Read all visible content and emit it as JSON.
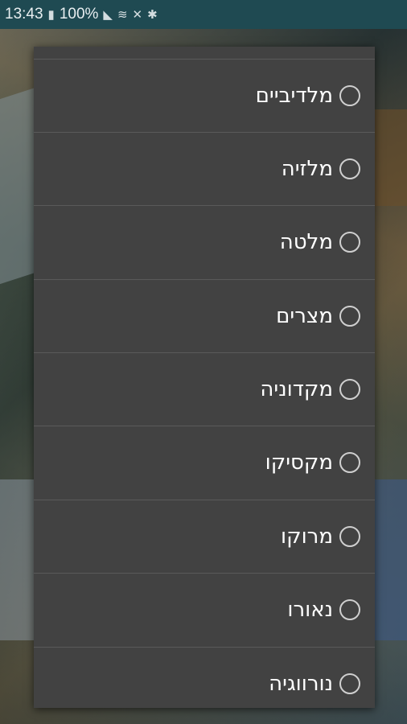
{
  "status_bar": {
    "time": "13:43",
    "battery": "100%"
  },
  "dialog": {
    "options": [
      {
        "label": "מלדיביים",
        "selected": false
      },
      {
        "label": "מלזיה",
        "selected": false
      },
      {
        "label": "מלטה",
        "selected": false
      },
      {
        "label": "מצרים",
        "selected": false
      },
      {
        "label": "מקדוניה",
        "selected": false
      },
      {
        "label": "מקסיקו",
        "selected": false
      },
      {
        "label": "מרוקו",
        "selected": false
      },
      {
        "label": "נאורו",
        "selected": false
      },
      {
        "label": "נורווגיה",
        "selected": false
      }
    ]
  },
  "colors": {
    "status_bar_bg": "#1f4a52",
    "dialog_bg": "#424242",
    "divider": "#5a5a5a",
    "text": "#ffffff"
  }
}
